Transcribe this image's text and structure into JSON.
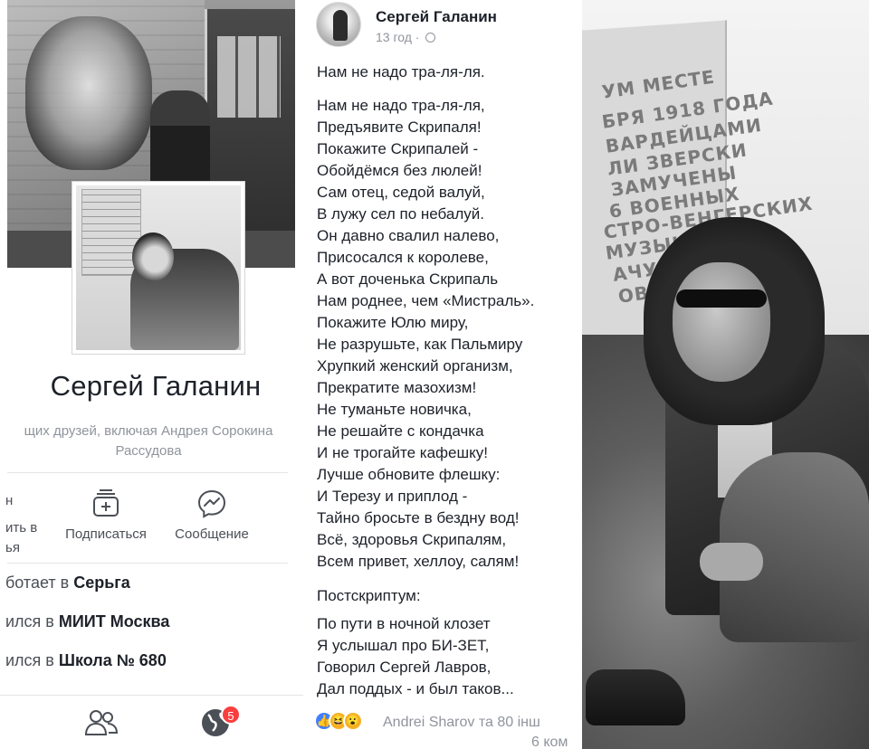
{
  "profile": {
    "name": "Сергей Галанин",
    "mutual_line1": "щих друзей, включая Андрея Сорокина",
    "mutual_line2": "Рассудова",
    "actions": {
      "clipped_line1": "н",
      "clipped_line2": "ить в",
      "clipped_line3": "ья",
      "subscribe": "Подписаться",
      "message": "Сообщение"
    },
    "info": [
      {
        "prefix": "ботает в ",
        "value": "Серьга"
      },
      {
        "prefix": "ился в ",
        "value": "МИИТ Москва"
      },
      {
        "prefix": "ился в ",
        "value": "Школа № 680"
      }
    ],
    "notifications_badge": "5"
  },
  "post": {
    "author": "Сергей Галанин",
    "time": "13 год ·",
    "lines": [
      "Нам не надо тра-ля-ля.",
      "Нам не надо тра-ля-ля,",
      "Предъявите Скрипаля!",
      "Покажите Скрипалей -",
      "Обойдёмся без люлей!",
      "Сам отец, седой валуй,",
      "В лужу сел по небалуй.",
      "Он давно свалил налево,",
      "Присосался к королеве,",
      "А вот доченька Скрипаль",
      "Нам роднее, чем «Мистраль».",
      "Покажите Юлю миру,",
      "Не разрушьте, как Пальмиру",
      "Хрупкий женский организм,",
      "Прекратите мазохизм!",
      "Не туманьте новичка,",
      "Не решайте с кондачка",
      "И не трогайте кафешку!",
      "Лучше обновите флешку:",
      "И Терезу и приплод -",
      "Тайно бросьте в бездну вод!",
      "Всё, здоровья Скрипалям,",
      "Всем привет, хеллоу, салям!",
      "Постскриптум:",
      "По пути в ночной клозет",
      "Я услышал про БИ-ЗЕТ,",
      "Говорил Сергей Лавров,",
      "Дал поддых - и был таков..."
    ],
    "reactions_text": "Andrei Sharov та 80 інш",
    "comments_text": "6 ком"
  },
  "photo": {
    "plaque_lines": [
      "УМ МЕСТЕ",
      "БРЯ 1918 ГОДА",
      "ВАРДЕЙЦАМИ",
      "ЛИ ЗВЕРСКИ",
      "ЗАМУЧЕНЫ",
      "6 ВОЕННЫХ",
      "СТРО-ВЕНГЕРСКИХ",
      "МУЗЫКАНТОВ",
      "АЧУВСТВ",
      "ОВЕТСКИ"
    ]
  },
  "colors": {
    "text_primary": "#1d2129",
    "text_secondary": "#90949c",
    "text_action": "#4b4f56",
    "badge": "#fa3e3e",
    "like_blue": "#4080ff"
  }
}
